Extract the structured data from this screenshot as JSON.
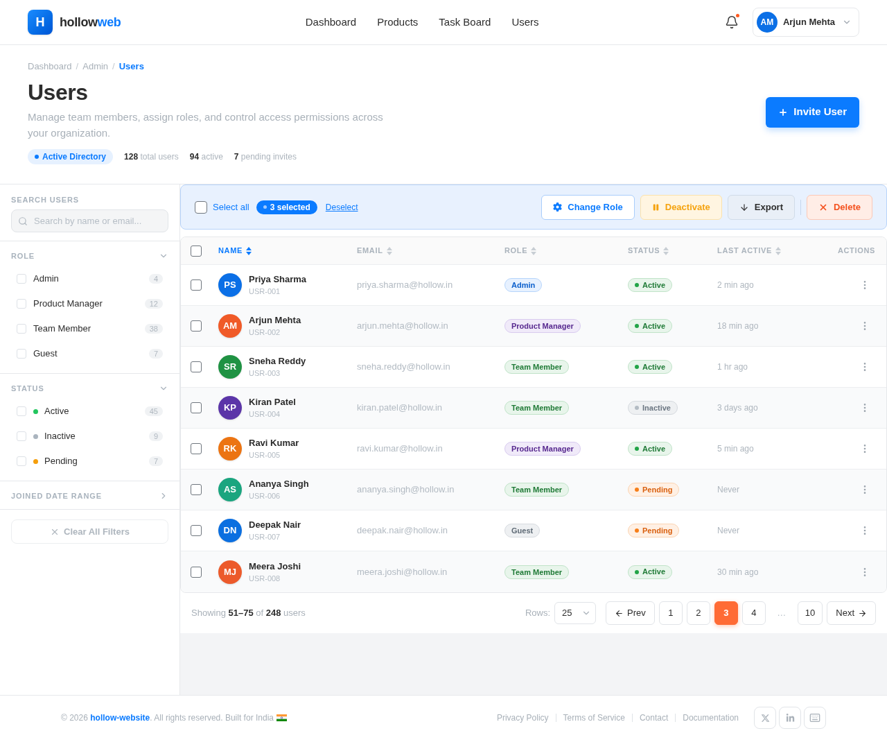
{
  "header": {
    "logo": {
      "mark": "H",
      "name": "hollow",
      "accent": "web"
    },
    "nav": [
      {
        "label": "Dashboard"
      },
      {
        "label": "Products"
      },
      {
        "label": "Task Board"
      },
      {
        "label": "Users"
      }
    ],
    "notifications": {
      "unread": true
    },
    "user": {
      "initials": "AM",
      "name": "Arjun Mehta"
    }
  },
  "page": {
    "breadcrumb": [
      {
        "label": "Dashboard",
        "current": false
      },
      {
        "separator": "/",
        "label": "Admin",
        "current": false
      },
      {
        "separator": "/",
        "label": "Users",
        "current": true
      }
    ],
    "title": "Users",
    "description": "Manage team members, assign roles, and control access permissions across your organization.",
    "directory_badge": "Active Directory",
    "stats": [
      "**128** total users",
      "**94** active",
      "**7** pending invites"
    ],
    "invite_button": "Invite User"
  },
  "filters": {
    "search": {
      "label": "SEARCH USERS",
      "placeholder": "Search by name or email..."
    },
    "sections": [
      {
        "title": "ROLE",
        "expanded": true,
        "options": [
          {
            "label": "Admin",
            "count": "4",
            "checked": false
          },
          {
            "label": "Product Manager",
            "count": "12",
            "checked": false
          },
          {
            "label": "Team Member",
            "count": "38",
            "checked": false
          },
          {
            "label": "Guest",
            "count": "7",
            "checked": false
          }
        ]
      },
      {
        "title": "STATUS",
        "expanded": true,
        "options": [
          {
            "label": "Active",
            "count": "45",
            "checked": false,
            "color": "#22c55e"
          },
          {
            "label": "Inactive",
            "count": "9",
            "checked": false,
            "color": "#aab4be"
          },
          {
            "label": "Pending",
            "count": "7",
            "checked": false,
            "color": "#f59e0b"
          }
        ]
      },
      {
        "title": "JOINED DATE RANGE",
        "expanded": false
      }
    ],
    "clear_button": {
      "label": "Clear All Filters",
      "disabled": true
    }
  },
  "bulk_bar": {
    "select_all": {
      "label": "Select all",
      "checked": false
    },
    "selected_count": "3 selected",
    "deselect": "Deselect",
    "actions": [
      {
        "label": "Change Role",
        "kind": "change-role"
      },
      {
        "label": "Deactivate",
        "kind": "deactivate"
      },
      {
        "label": "Export",
        "kind": "export"
      },
      {
        "label": "Delete",
        "kind": "delete"
      }
    ]
  },
  "table": {
    "all_checked": false,
    "columns": [
      {
        "label": "NAME",
        "kind": "sortable",
        "sorted": true
      },
      {
        "label": "EMAIL",
        "kind": "sortable",
        "sorted": false
      },
      {
        "label": "ROLE",
        "kind": "sortable",
        "sorted": false
      },
      {
        "label": "STATUS",
        "kind": "sortable",
        "sorted": false
      },
      {
        "label": "LAST ACTIVE",
        "kind": "sortable",
        "sorted": false
      },
      {
        "label": "ACTIONS",
        "kind": "static"
      }
    ],
    "rows": [
      {
        "checked": false,
        "avatar": {
          "initials": "PS",
          "color": "#0b6fe6"
        },
        "name": "Priya Sharma",
        "id": "USR-001",
        "email": "priya.sharma@hollow.in",
        "role": {
          "label": "Admin",
          "kind": "admin"
        },
        "status": {
          "label": "Active",
          "kind": "active"
        },
        "last_active": "2 min ago"
      },
      {
        "checked": false,
        "avatar": {
          "initials": "AM",
          "color": "#f05a28"
        },
        "name": "Arjun Mehta",
        "id": "USR-002",
        "email": "arjun.mehta@hollow.in",
        "role": {
          "label": "Product Manager",
          "kind": "manager"
        },
        "status": {
          "label": "Active",
          "kind": "active"
        },
        "last_active": "18 min ago"
      },
      {
        "checked": false,
        "avatar": {
          "initials": "SR",
          "color": "#1f9243"
        },
        "name": "Sneha Reddy",
        "id": "USR-003",
        "email": "sneha.reddy@hollow.in",
        "role": {
          "label": "Team Member",
          "kind": "member"
        },
        "status": {
          "label": "Active",
          "kind": "active"
        },
        "last_active": "1 hr ago"
      },
      {
        "checked": false,
        "avatar": {
          "initials": "KP",
          "color": "#5b35a8"
        },
        "name": "Kiran Patel",
        "id": "USR-004",
        "email": "kiran.patel@hollow.in",
        "role": {
          "label": "Team Member",
          "kind": "member"
        },
        "status": {
          "label": "Inactive",
          "kind": "inactive"
        },
        "last_active": "3 days ago"
      },
      {
        "checked": false,
        "avatar": {
          "initials": "RK",
          "color": "#ec7412"
        },
        "name": "Ravi Kumar",
        "id": "USR-005",
        "email": "ravi.kumar@hollow.in",
        "role": {
          "label": "Product Manager",
          "kind": "manager"
        },
        "status": {
          "label": "Active",
          "kind": "active"
        },
        "last_active": "5 min ago"
      },
      {
        "checked": false,
        "avatar": {
          "initials": "AS",
          "color": "#1aa57f"
        },
        "name": "Ananya Singh",
        "id": "USR-006",
        "email": "ananya.singh@hollow.in",
        "role": {
          "label": "Team Member",
          "kind": "member"
        },
        "status": {
          "label": "Pending",
          "kind": "pending"
        },
        "last_active": "Never"
      },
      {
        "checked": false,
        "avatar": {
          "initials": "DN",
          "color": "#0b6fe0"
        },
        "name": "Deepak Nair",
        "id": "USR-007",
        "email": "deepak.nair@hollow.in",
        "role": {
          "label": "Guest",
          "kind": "guest"
        },
        "status": {
          "label": "Pending",
          "kind": "pending"
        },
        "last_active": "Never"
      },
      {
        "checked": false,
        "avatar": {
          "initials": "MJ",
          "color": "#ec5a2b"
        },
        "name": "Meera Joshi",
        "id": "USR-008",
        "email": "meera.joshi@hollow.in",
        "role": {
          "label": "Team Member",
          "kind": "member"
        },
        "status": {
          "label": "Active",
          "kind": "active"
        },
        "last_active": "30 min ago"
      }
    ]
  },
  "pagination": {
    "summary": "Showing **51–75** of **248** users",
    "rows_label": "Rows:",
    "rows_value": "25",
    "prev": "Prev",
    "next": "Next",
    "pages": [
      {
        "label": "1",
        "kind": "page",
        "selected": false
      },
      {
        "label": "2",
        "kind": "page",
        "selected": false
      },
      {
        "label": "3",
        "kind": "page",
        "selected": true
      },
      {
        "label": "4",
        "kind": "page",
        "selected": false
      },
      {
        "label": "…",
        "kind": "gap"
      },
      {
        "label": "10",
        "kind": "page",
        "selected": false
      }
    ]
  },
  "footer": {
    "copyright": {
      "before": "© 2026 ",
      "link": "hollow-website",
      "after": ". All rights reserved. Built for India"
    },
    "links": [
      "Privacy Policy",
      "Terms of Service",
      "Contact",
      "Documentation"
    ]
  }
}
